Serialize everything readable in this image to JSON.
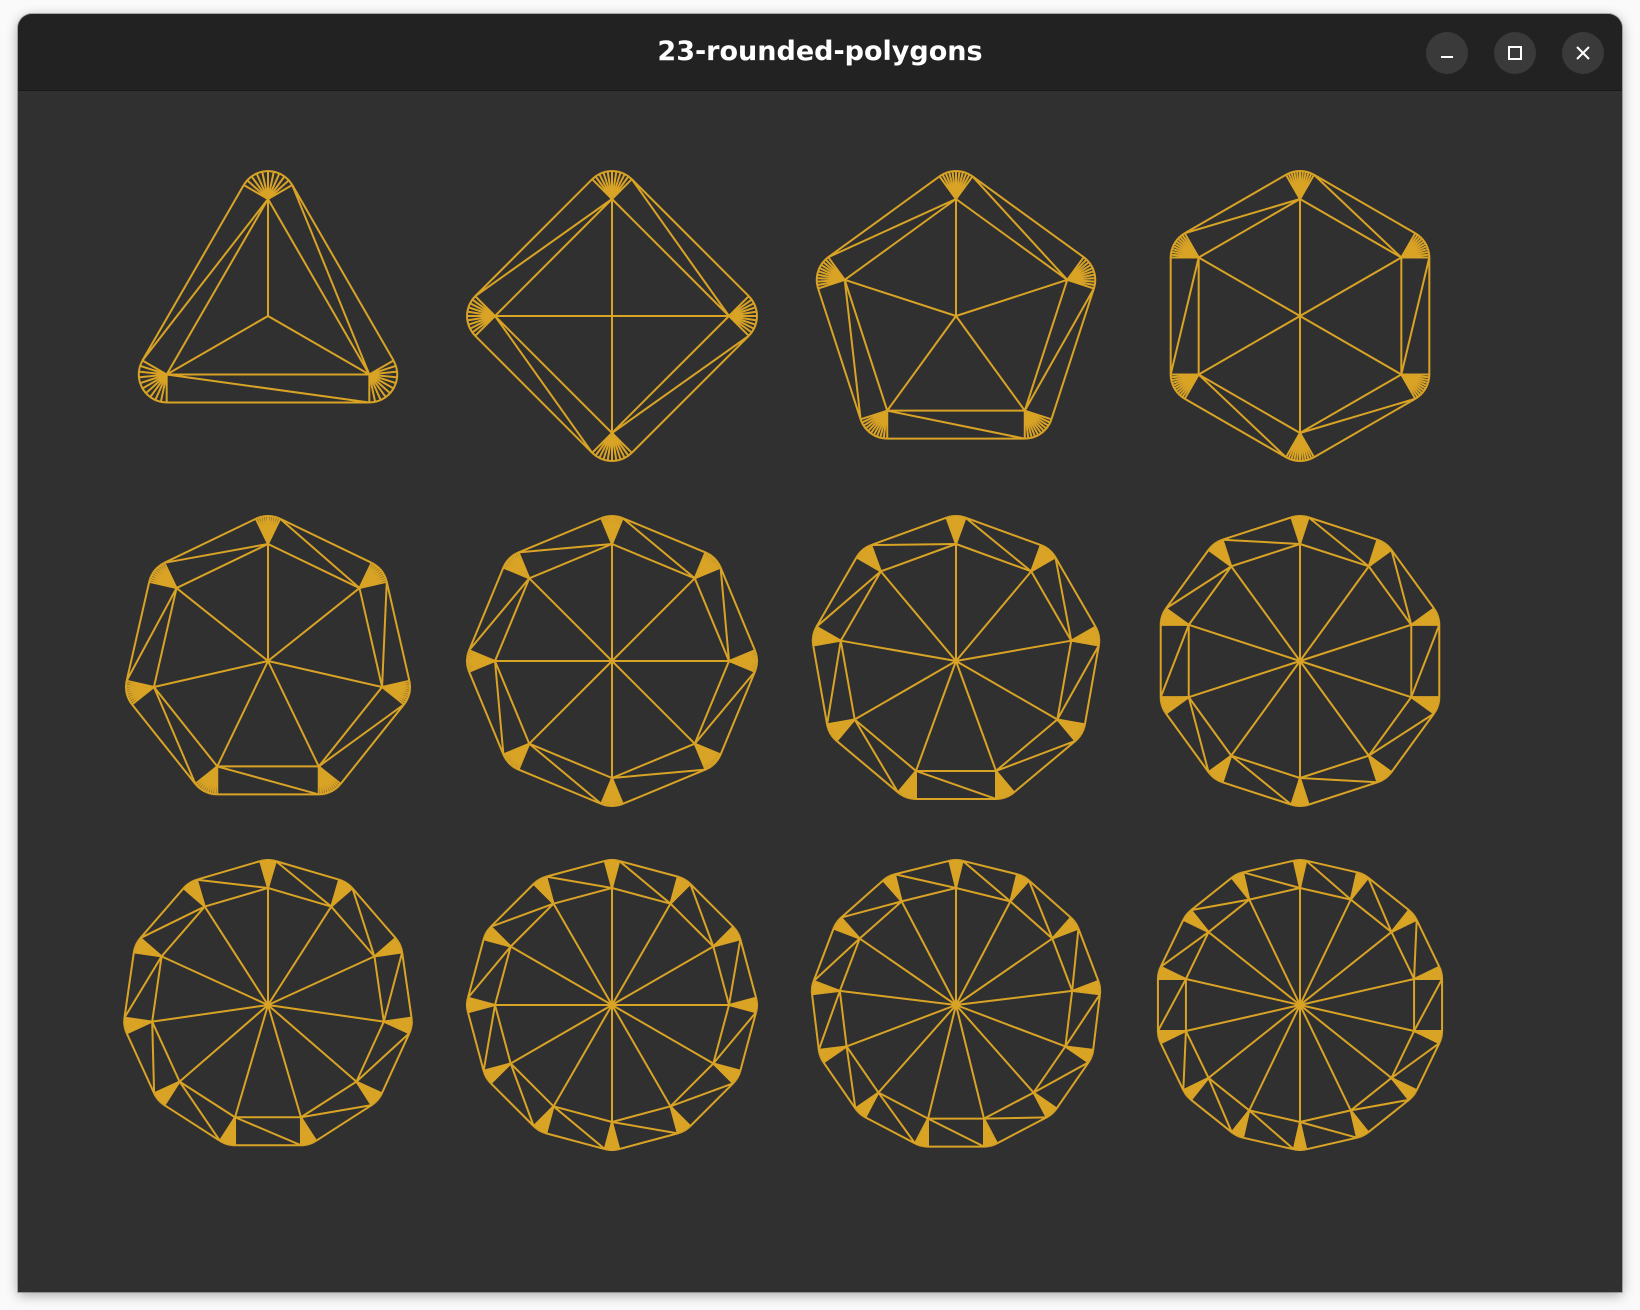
{
  "window": {
    "title": "23-rounded-polygons",
    "controls": {
      "minimize_icon": "minimize-icon",
      "maximize_icon": "maximize-icon",
      "close_icon": "close-icon"
    }
  },
  "theme": {
    "background": "#303030",
    "titlebar": "#222222",
    "stroke": "#d9a325"
  },
  "polygons": {
    "rows": 3,
    "columns": 4,
    "sides": [
      3,
      4,
      5,
      6,
      7,
      8,
      9,
      10,
      11,
      12,
      13,
      14
    ]
  }
}
